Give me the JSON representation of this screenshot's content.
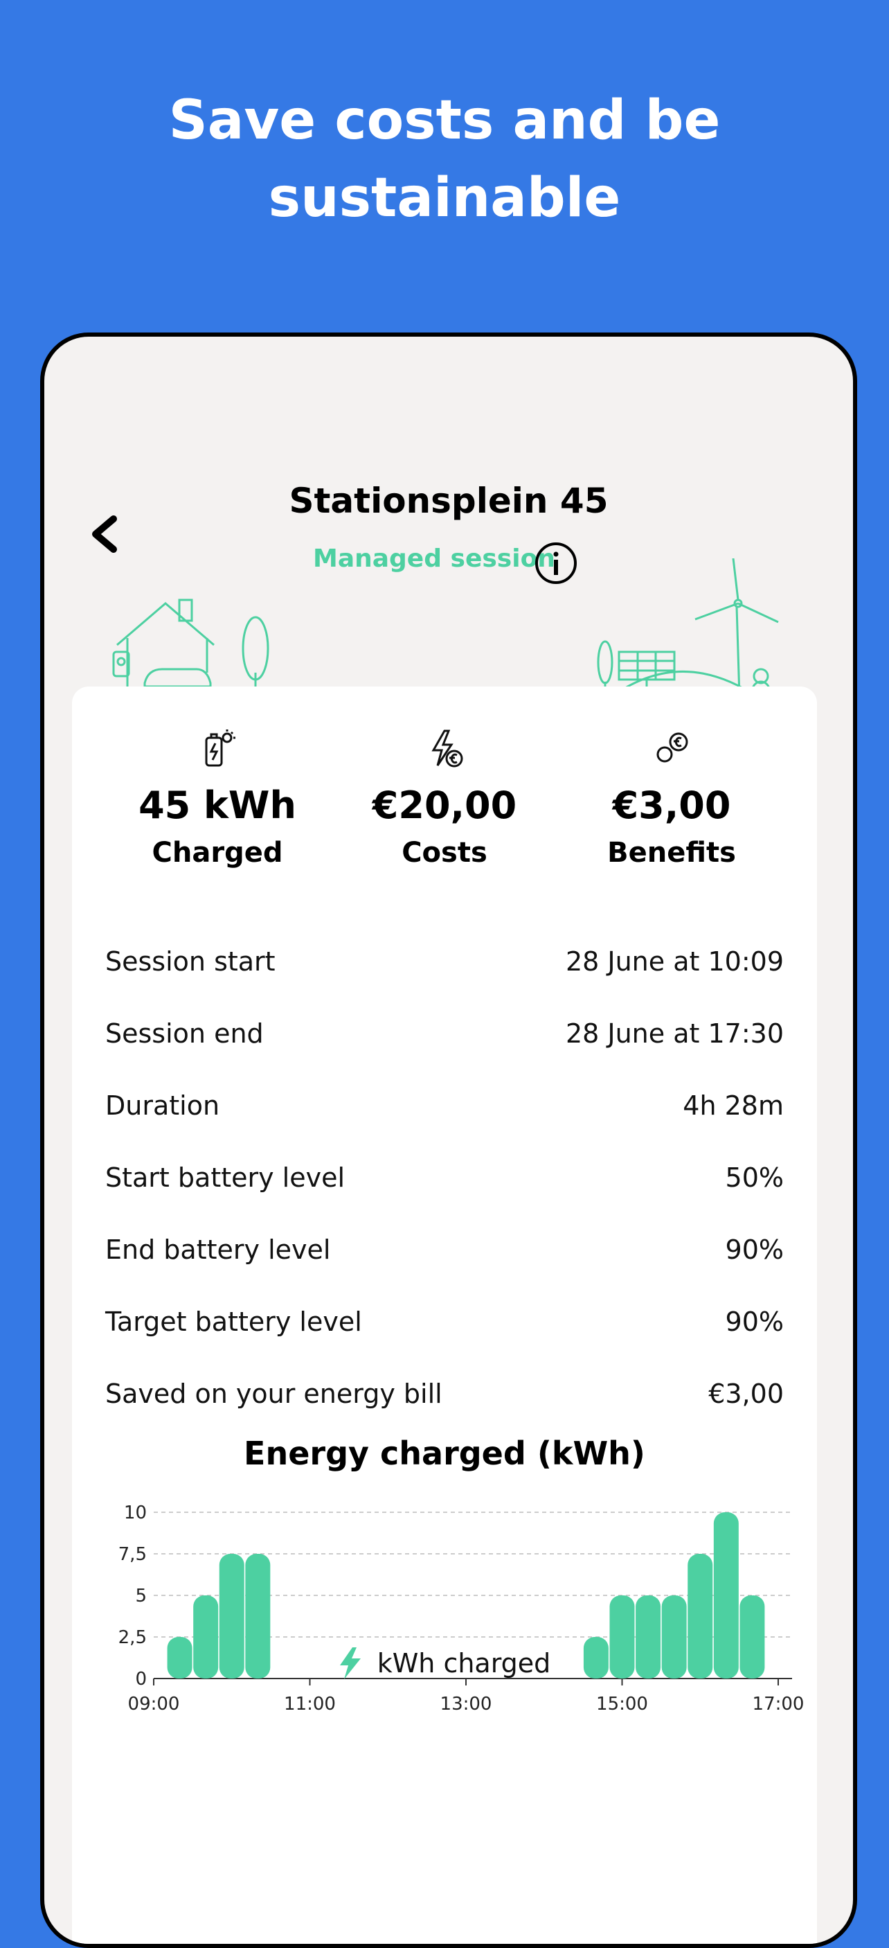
{
  "headline": {
    "line1": "Save costs and be",
    "line2": "sustainable"
  },
  "header": {
    "title": "Stationsplein 45",
    "managed_label": "Managed session"
  },
  "stats": [
    {
      "icon": "battery-sun-icon",
      "value": "45 kWh",
      "label": "Charged"
    },
    {
      "icon": "bolt-euro-icon",
      "value": "€20,00",
      "label": "Costs"
    },
    {
      "icon": "coins-euro-icon",
      "value": "€3,00",
      "label": "Benefits"
    }
  ],
  "details": [
    {
      "label": "Session start",
      "value": "28 June at 10:09"
    },
    {
      "label": "Session end",
      "value": "28 June at 17:30"
    },
    {
      "label": "Duration",
      "value": "4h 28m"
    },
    {
      "label": "Start battery level",
      "value": "50%"
    },
    {
      "label": "End battery level",
      "value": "90%"
    },
    {
      "label": "Target battery level",
      "value": "90%"
    },
    {
      "label": "Saved on your energy bill",
      "value": "€3,00"
    }
  ],
  "colors": {
    "accent": "#4DD0A1",
    "background": "#3579E5",
    "phone_bg": "#F4F2F1"
  },
  "chart_data": {
    "type": "bar",
    "title": "Energy charged (kWh)",
    "ylim": [
      0,
      10
    ],
    "yticks": [
      "0",
      "2,5",
      "5",
      "7,5",
      "10"
    ],
    "xticks": [
      "09:00",
      "11:00",
      "13:00",
      "15:00",
      "17:00"
    ],
    "x": [
      "09:20",
      "09:40",
      "10:00",
      "10:20",
      "10:40",
      "14:40",
      "15:00",
      "15:20",
      "15:40",
      "16:00",
      "16:20",
      "16:40",
      "17:00"
    ],
    "series": [
      {
        "name": "kWh charged",
        "values": [
          2.5,
          5,
          7.5,
          7.5,
          0,
          2.5,
          5,
          5,
          5,
          7.5,
          10,
          5,
          0
        ]
      }
    ],
    "grid": true,
    "legend": "bottom"
  }
}
